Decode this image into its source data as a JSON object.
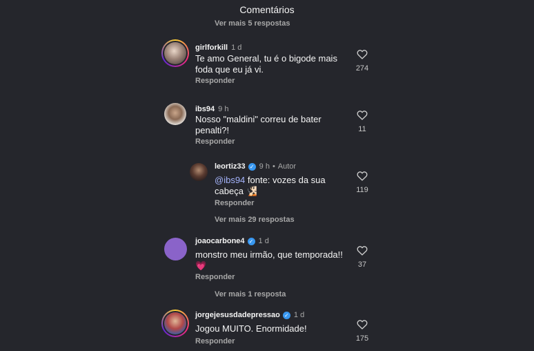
{
  "header": {
    "title": "Comentários"
  },
  "top_more": "Ver mais 5 respostas",
  "reply_label": "Responder",
  "colors": {
    "accent": "#3897f0",
    "mention": "#a5b4fc",
    "background": "#25262c"
  },
  "icons": {
    "like": "heart-outline-icon",
    "verified": "verified-badge-icon"
  },
  "comments": [
    {
      "username": "girlforkill",
      "time": "1 d",
      "text": "Te amo General, tu é o bigode mais foda que eu já vi.",
      "likes": "274"
    },
    {
      "username": "ibs94",
      "time": "9 h",
      "text": "Nosso \"maldini\" correu de bater penalti?!",
      "likes": "11",
      "replies": [
        {
          "username": "leortiz33",
          "time": "9 h",
          "author_sep": "•",
          "author": "Autor",
          "mention": "@ibs94",
          "text": " fonte: vozes da sua cabeça 🧏🏻",
          "likes": "119"
        }
      ],
      "more": "Ver mais 29 respostas"
    },
    {
      "username": "joaocarbone4",
      "time": "1 d",
      "text": "monstro meu irmão, que temporada!! 💗",
      "likes": "37",
      "more": "Ver mais 1 resposta"
    },
    {
      "username": "jorgejesusdadepressao",
      "time": "1 d",
      "text": "Jogou MUITO. Enormidade!",
      "likes": "175"
    }
  ]
}
